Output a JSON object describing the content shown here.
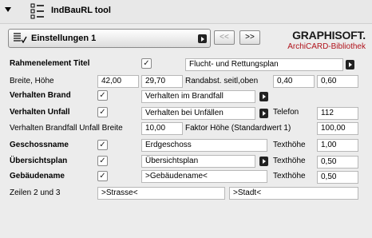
{
  "header": {
    "title": "IndBauRL tool",
    "collapse_icon": "triangle-down-icon",
    "tool_icon": "grid-list-icon"
  },
  "page_selector": {
    "icon": "list-checkbox-icon",
    "label": "Einstellungen 1",
    "prev_label": "<<",
    "next_label": ">>"
  },
  "brand": {
    "name": "GRAPHISOFT.",
    "library": "ArchiCARD-Bibliothek",
    "accent": "#b0121b"
  },
  "rows": {
    "rahmen": {
      "label": "Rahmenelement Titel",
      "checked": "✓",
      "value": "Flucht- und Rettungsplan"
    },
    "breite": {
      "label": "Breite, Höhe",
      "w": "42,00",
      "h": "29,70",
      "rand_label": "Randabst. seitl,oben",
      "r1": "0,40",
      "r2": "0,60"
    },
    "brand_v": {
      "label": "Verhalten Brand",
      "checked": "✓",
      "value": "Verhalten im Brandfall"
    },
    "unfall": {
      "label": "Verhalten Unfall",
      "checked": "✓",
      "value": "Verhalten bei Unfällen",
      "tel_label": "Telefon",
      "tel": "112"
    },
    "breite2": {
      "label": "Verhalten Brandfall Unfall Breite",
      "value": "10,00",
      "faktor_label": "Faktor Höhe (Standardwert 1)",
      "faktor": "100,00"
    },
    "geschoss": {
      "label": "Geschossname",
      "checked": "✓",
      "value": "Erdgeschoss",
      "th_label": "Texthöhe",
      "th": "1,00"
    },
    "uebersicht": {
      "label": "Übersichtsplan",
      "checked": "✓",
      "value": "Übersichtsplan",
      "th_label": "Texthöhe",
      "th": "0,50"
    },
    "gebaeude": {
      "label": "Gebäudename",
      "checked": "✓",
      "value": ">Gebäudename<",
      "th_label": "Texthöhe",
      "th": "0,50"
    },
    "zeilen": {
      "label": "Zeilen 2 und 3",
      "v1": ">Strasse<",
      "v2": ">Stadt<"
    }
  }
}
